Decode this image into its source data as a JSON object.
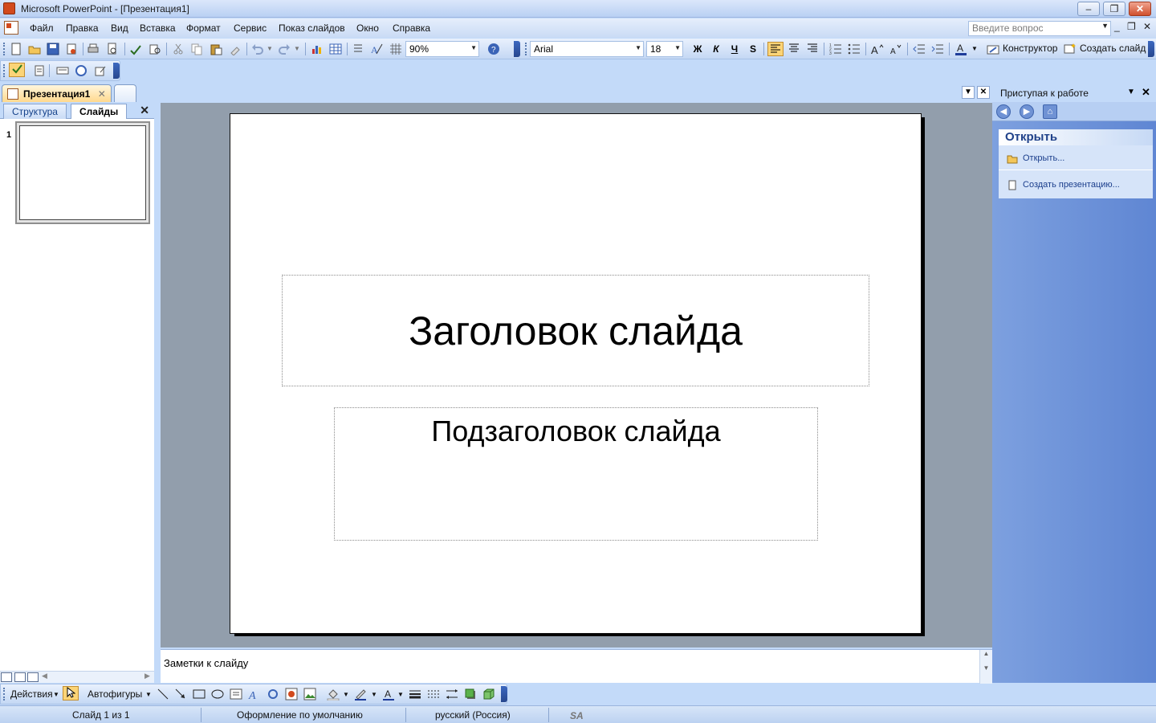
{
  "window": {
    "title": "Microsoft PowerPoint - [Презентация1]",
    "min_glyph": "–",
    "max_glyph": "❐",
    "close_glyph": "✕"
  },
  "menu": {
    "items": [
      "Файл",
      "Правка",
      "Вид",
      "Вставка",
      "Формат",
      "Сервис",
      "Показ слайдов",
      "Окно",
      "Справка"
    ],
    "help_placeholder": "Введите вопрос"
  },
  "toolbar": {
    "zoom": "90%",
    "font_name": "Arial",
    "font_size": "18",
    "bold": "Ж",
    "italic": "К",
    "underline": "Ч",
    "shadow": "S",
    "designer": "Конструктор",
    "new_slide": "Создать слайд"
  },
  "doc_tabs": {
    "active": "Презентация1",
    "close_glyph": "✕"
  },
  "left_pane": {
    "tabs": [
      "Структура",
      "Слайды"
    ],
    "active_tab": "Слайды",
    "slide_number": "1"
  },
  "slide": {
    "title": "Заголовок слайда",
    "subtitle": "Подзаголовок слайда"
  },
  "notes": {
    "placeholder": "Заметки к слайду"
  },
  "task_pane": {
    "title": "Приступая к работе",
    "section_title": "Открыть",
    "links": [
      "Открыть...",
      "Создать презентацию..."
    ]
  },
  "draw_toolbar": {
    "actions": "Действия",
    "autoshapes": "Автофигуры"
  },
  "status": {
    "slide": "Слайд 1 из 1",
    "design": "Оформление по умолчанию",
    "language": "русский (Россия)"
  },
  "colors": {
    "accent": "#c3daf9",
    "task_pane": "#6b8fd6",
    "active_button": "#fbd477"
  }
}
